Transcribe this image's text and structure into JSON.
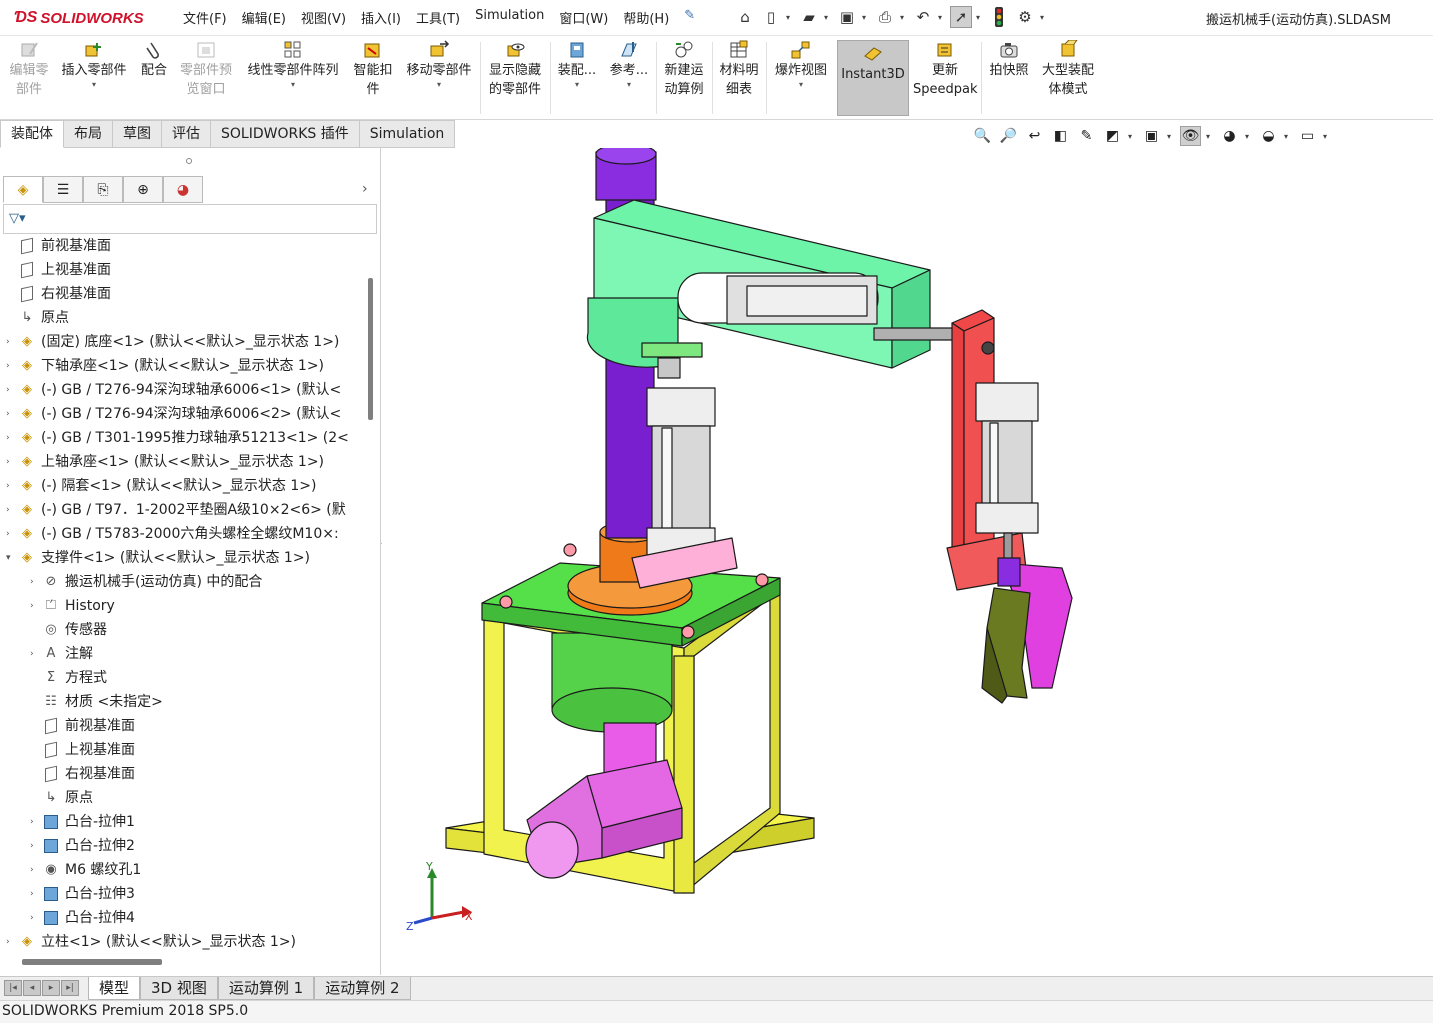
{
  "app": {
    "logo_text": "SOLIDWORKS",
    "document_title": "搬运机械手(运动仿真).SLDASM"
  },
  "menu": [
    "文件(F)",
    "编辑(E)",
    "视图(V)",
    "插入(I)",
    "工具(T)",
    "Simulation",
    "窗口(W)",
    "帮助(H)"
  ],
  "commands": {
    "edit_component": [
      "编辑零",
      "部件"
    ],
    "insert_component": "插入零部件",
    "mate": "配合",
    "component_preview": [
      "零部件预",
      "览窗口"
    ],
    "linear_pattern": "线性零部件阵列",
    "smart_fasteners": [
      "智能扣",
      "件"
    ],
    "move_component": "移动零部件",
    "show_hidden": [
      "显示隐藏",
      "的零部件"
    ],
    "assembly_features": "装配...",
    "reference": "参考...",
    "new_motion_study": [
      "新建运",
      "动算例"
    ],
    "bom": [
      "材料明",
      "细表"
    ],
    "exploded_view": "爆炸视图",
    "instant3d": "Instant3D",
    "update_speedpak": [
      "更新",
      "Speedpak"
    ],
    "snapshot": "拍快照",
    "large_assembly": [
      "大型装配",
      "体模式"
    ]
  },
  "tabs": [
    "装配体",
    "布局",
    "草图",
    "评估",
    "SOLIDWORKS 插件",
    "Simulation"
  ],
  "tree": [
    {
      "label": "前视基准面",
      "icon": "plane-icon",
      "level": 1,
      "expandable": false
    },
    {
      "label": "上视基准面",
      "icon": "plane-icon",
      "level": 1,
      "expandable": false
    },
    {
      "label": "右视基准面",
      "icon": "plane-icon",
      "level": 1,
      "expandable": false
    },
    {
      "label": "原点",
      "icon": "origin-icon",
      "level": 1,
      "expandable": false
    },
    {
      "label": "(固定) 底座<1> (默认<<默认>_显示状态 1>)",
      "icon": "part-icon",
      "level": 1,
      "expandable": true
    },
    {
      "label": "下轴承座<1> (默认<<默认>_显示状态 1>)",
      "icon": "part-icon",
      "level": 1,
      "expandable": true
    },
    {
      "label": "(-) GB / T276-94深沟球轴承6006<1> (默认<",
      "icon": "part-icon",
      "level": 1,
      "expandable": true
    },
    {
      "label": "(-) GB / T276-94深沟球轴承6006<2> (默认<",
      "icon": "part-icon",
      "level": 1,
      "expandable": true
    },
    {
      "label": "(-) GB / T301-1995推力球轴承51213<1> (2<",
      "icon": "part-icon",
      "level": 1,
      "expandable": true
    },
    {
      "label": "上轴承座<1> (默认<<默认>_显示状态 1>)",
      "icon": "part-icon",
      "level": 1,
      "expandable": true
    },
    {
      "label": "(-) 隔套<1> (默认<<默认>_显示状态 1>)",
      "icon": "part-icon",
      "level": 1,
      "expandable": true
    },
    {
      "label": "(-) GB / T97．1-2002平垫圈A级10×2<6> (默",
      "icon": "part-icon",
      "level": 1,
      "expandable": true
    },
    {
      "label": "(-) GB / T5783-2000六角头螺栓全螺纹M10×:",
      "icon": "part-icon",
      "level": 1,
      "expandable": true
    },
    {
      "label": "支撑件<1> (默认<<默认>_显示状态 1>)",
      "icon": "part-icon",
      "level": 1,
      "expandable": true,
      "expanded": true
    },
    {
      "label": "搬运机械手(运动仿真) 中的配合",
      "icon": "mates-icon",
      "level": 2,
      "expandable": true
    },
    {
      "label": "History",
      "icon": "history-icon",
      "level": 2,
      "expandable": true
    },
    {
      "label": "传感器",
      "icon": "sensor-icon",
      "level": 2,
      "expandable": false
    },
    {
      "label": "注解",
      "icon": "annotation-icon",
      "level": 2,
      "expandable": true
    },
    {
      "label": "方程式",
      "icon": "equation-icon",
      "level": 2,
      "expandable": false
    },
    {
      "label": "材质 <未指定>",
      "icon": "material-icon",
      "level": 2,
      "expandable": false
    },
    {
      "label": "前视基准面",
      "icon": "plane-icon",
      "level": 2,
      "expandable": false
    },
    {
      "label": "上视基准面",
      "icon": "plane-icon",
      "level": 2,
      "expandable": false
    },
    {
      "label": "右视基准面",
      "icon": "plane-icon",
      "level": 2,
      "expandable": false
    },
    {
      "label": "原点",
      "icon": "origin-icon",
      "level": 2,
      "expandable": false
    },
    {
      "label": "凸台-拉伸1",
      "icon": "extrude-icon",
      "level": 2,
      "expandable": true
    },
    {
      "label": "凸台-拉伸2",
      "icon": "extrude-icon",
      "level": 2,
      "expandable": true
    },
    {
      "label": "M6 螺纹孔1",
      "icon": "hole-icon",
      "level": 2,
      "expandable": true
    },
    {
      "label": "凸台-拉伸3",
      "icon": "extrude-icon",
      "level": 2,
      "expandable": true
    },
    {
      "label": "凸台-拉伸4",
      "icon": "extrude-icon",
      "level": 2,
      "expandable": true
    },
    {
      "label": "立柱<1> (默认<<默认>_显示状态 1>)",
      "icon": "part-icon",
      "level": 1,
      "expandable": true
    }
  ],
  "bottom_tabs": [
    "模型",
    "3D 视图",
    "运动算例 1",
    "运动算例 2"
  ],
  "status": "SOLIDWORKS Premium 2018 SP5.0",
  "triad": {
    "x": "X",
    "y": "Y",
    "z": "Z"
  }
}
